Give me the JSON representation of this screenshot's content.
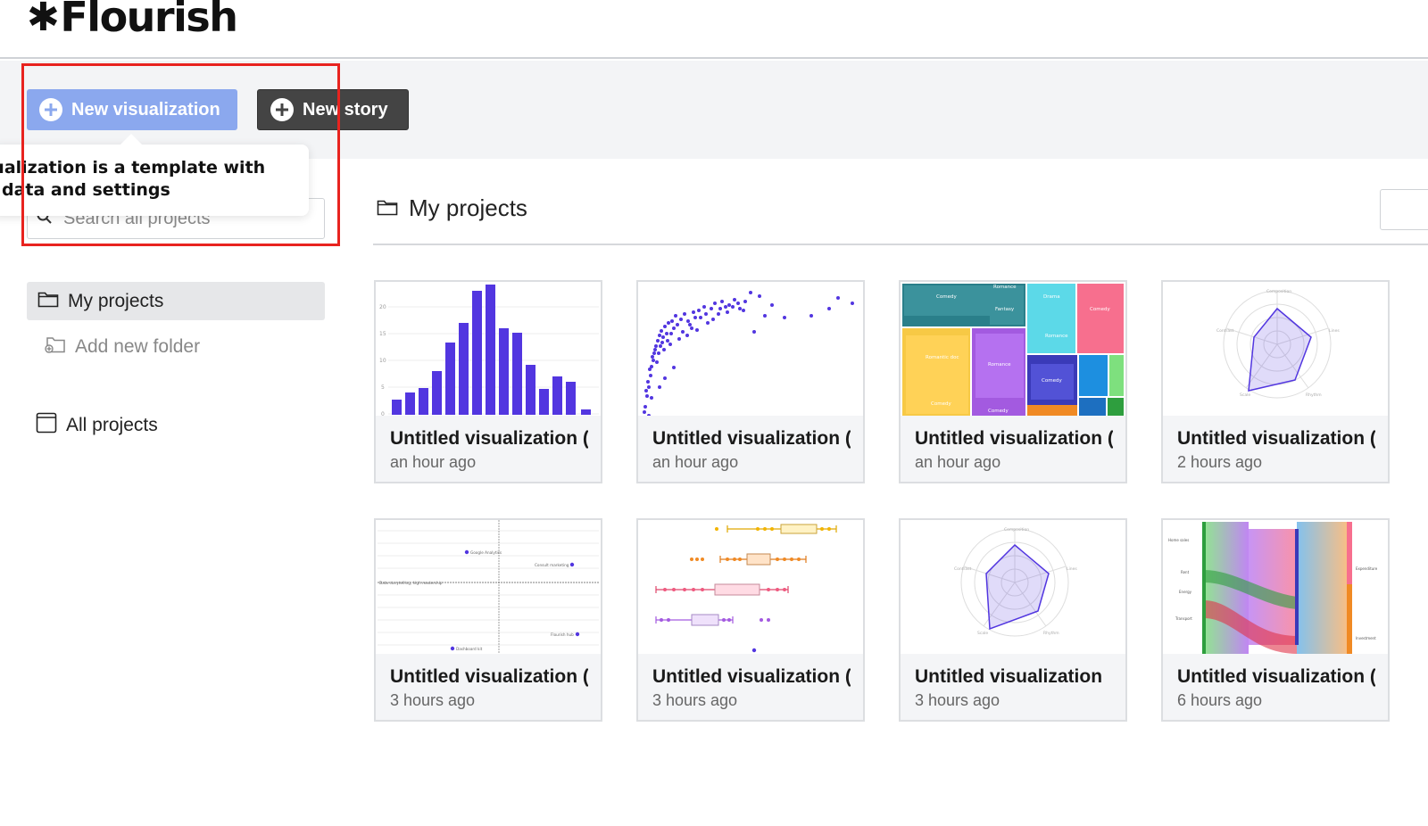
{
  "header": {
    "logo_text": "Flourish",
    "logo_icon": "asterisk-icon"
  },
  "actions": {
    "new_visualization_label": "New visualization",
    "new_story_label": "New story",
    "accent_color": "#8ba8ee",
    "story_button_color": "#444444"
  },
  "tooltip": {
    "line1": "sualization is a template with",
    "line2": "r data and settings"
  },
  "search": {
    "placeholder": "Search all projects"
  },
  "sidebar": {
    "my_projects": "My projects",
    "add_new_folder": "Add new folder",
    "all_projects": "All projects"
  },
  "main": {
    "heading": "My projects"
  },
  "cards": [
    {
      "title": "Untitled visualization (",
      "time": "an hour ago",
      "thumb": "bar-chart"
    },
    {
      "title": "Untitled visualization (",
      "time": "an hour ago",
      "thumb": "scatter-plot"
    },
    {
      "title": "Untitled visualization (",
      "time": "an hour ago",
      "thumb": "treemap"
    },
    {
      "title": "Untitled visualization (",
      "time": "2 hours ago",
      "thumb": "radar-chart"
    },
    {
      "title": "Untitled visualization (",
      "time": "3 hours ago",
      "thumb": "dot-quadrant"
    },
    {
      "title": "Untitled visualization (",
      "time": "3 hours ago",
      "thumb": "box-plot"
    },
    {
      "title": "Untitled visualization",
      "time": "3 hours ago",
      "thumb": "radar-chart"
    },
    {
      "title": "Untitled visualization (",
      "time": "6 hours ago",
      "thumb": "sankey"
    }
  ],
  "highlight_color": "#e8231f"
}
